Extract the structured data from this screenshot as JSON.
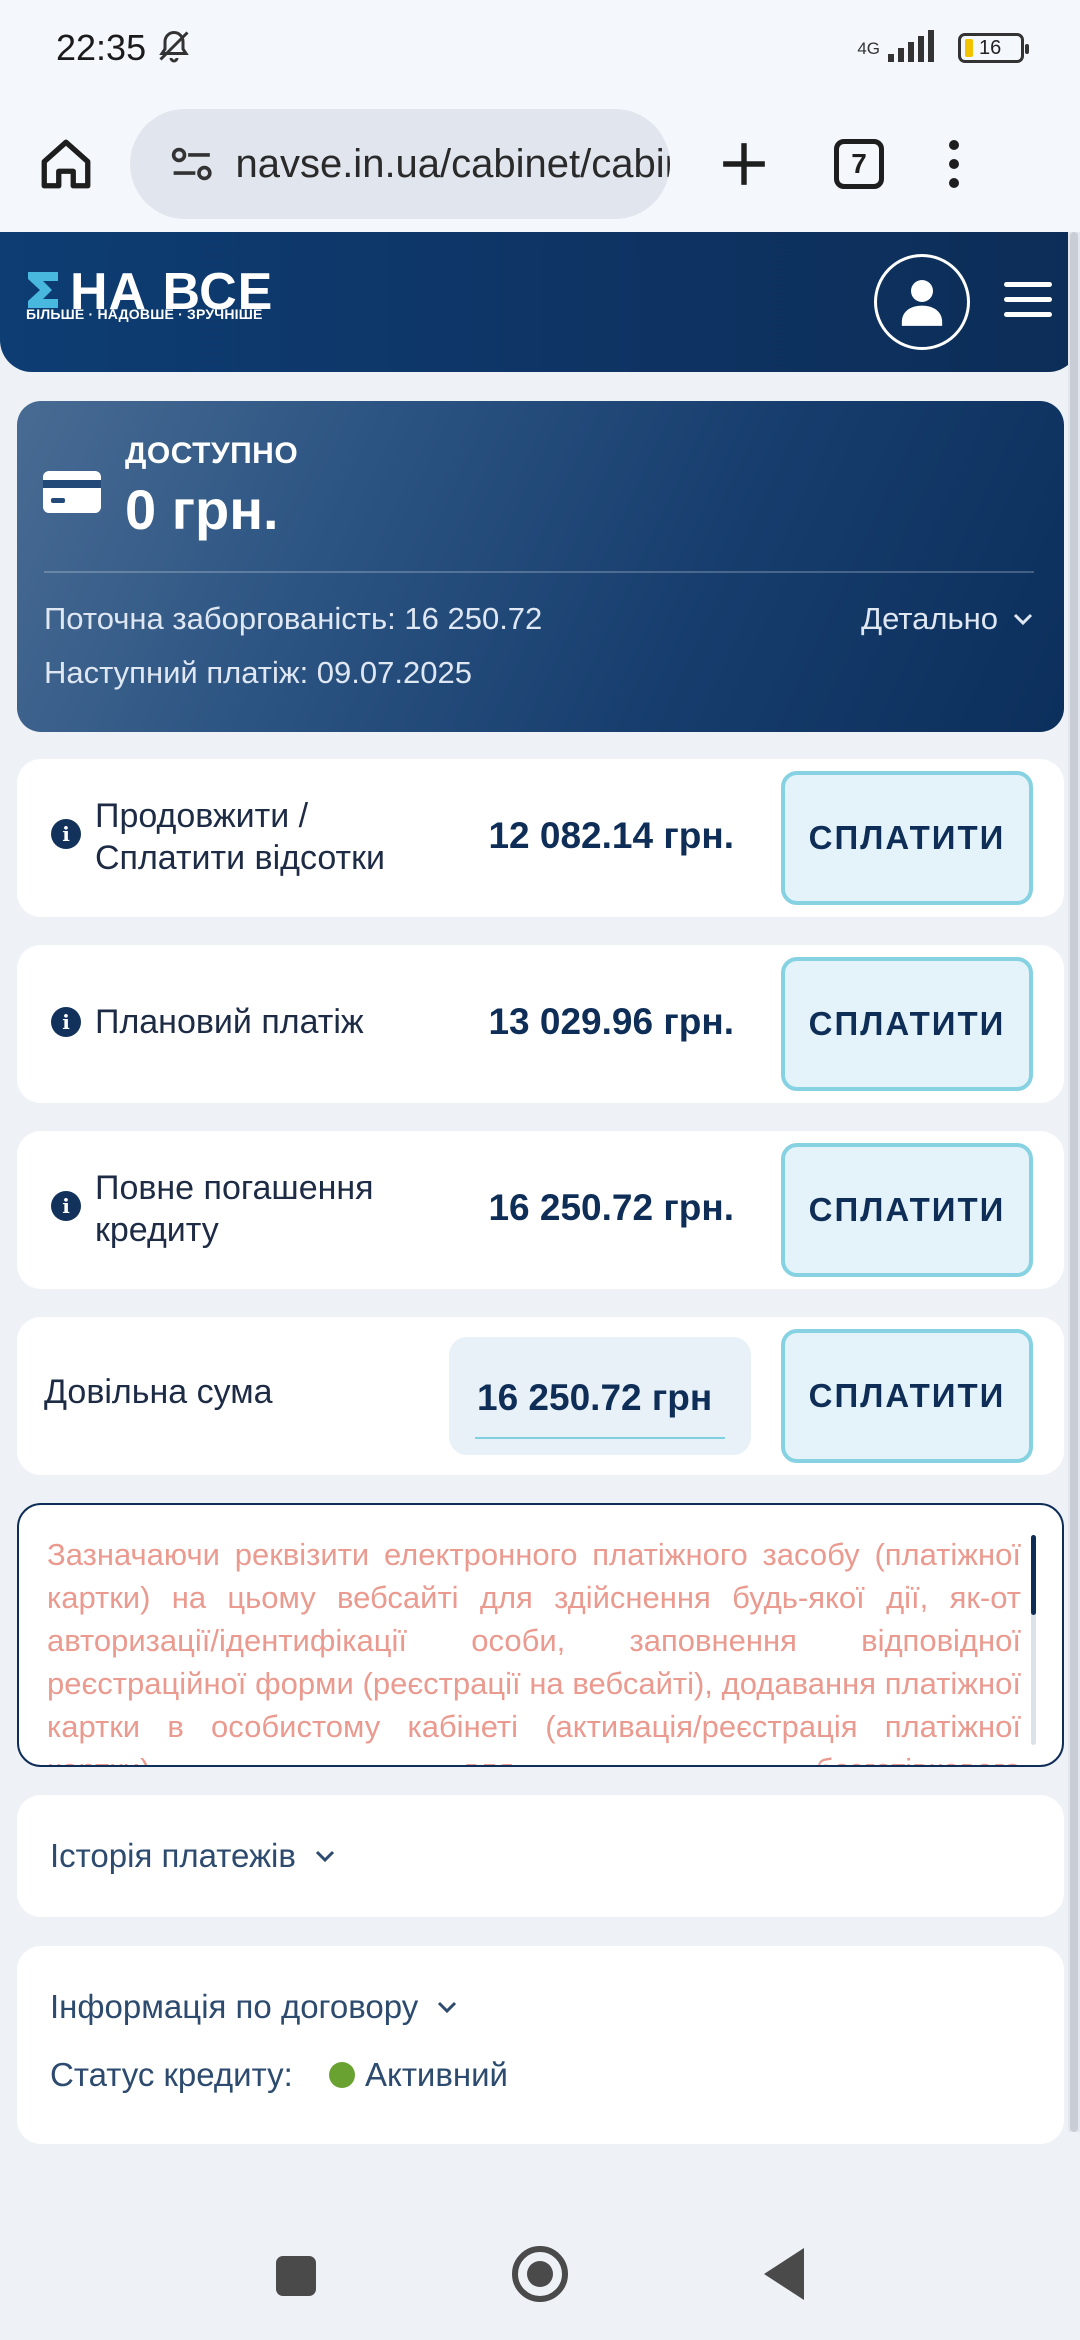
{
  "status_bar": {
    "time": "22:35",
    "network": "4G",
    "battery": "16"
  },
  "browser": {
    "url": "navse.in.ua/cabinet/cabinet",
    "tab_count": "7"
  },
  "site": {
    "brand": "НА ВСЕ",
    "slogan": "БІЛЬШЕ · НАДОВШЕ · ЗРУЧНІШЕ"
  },
  "balance": {
    "available_label": "ДОСТУПНО",
    "available_amount": "0 грн.",
    "debt_text": "Поточна заборгованість: 16 250.72",
    "next_payment_text": "Наступний платіж: 09.07.2025",
    "details_label": "Детально"
  },
  "payments": [
    {
      "label": "Продовжити / Сплатити відсотки",
      "amount": "12 082.14 грн.",
      "button": "СПЛАТИТИ"
    },
    {
      "label": "Плановий платіж",
      "amount": "13 029.96 грн.",
      "button": "СПЛАТИТИ"
    },
    {
      "label": "Повне погашення кредиту",
      "amount": "16 250.72 грн.",
      "button": "СПЛАТИТИ"
    }
  ],
  "custom_payment": {
    "label": "Довільна сума",
    "value": "16 250.72 грн",
    "button": "СПЛАТИТИ"
  },
  "terms": {
    "text": "Зазначаючи реквізити електронного платіжного засобу (платіжної картки) на цьому вебсайті для здійснення будь-якої дії, як-от авторизації/ідентифікації особи, заповнення відповідної реєстраційної форми (реєстрації на вебсайті), додавання платіжної картки в особистому кабінеті (активація/реєстрація платіжної картки), для безготівкового"
  },
  "history": {
    "title": "Історія платежів"
  },
  "contract": {
    "title": "Інформація по договору",
    "status_label": "Статус кредиту:",
    "status_value": "Активний",
    "status_color": "#6aa232"
  },
  "colors": {
    "navy": "#0f2e57",
    "button_border": "#86d2e2",
    "button_bg": "#e3f3f9",
    "terms_text": "#ea9a8f"
  }
}
